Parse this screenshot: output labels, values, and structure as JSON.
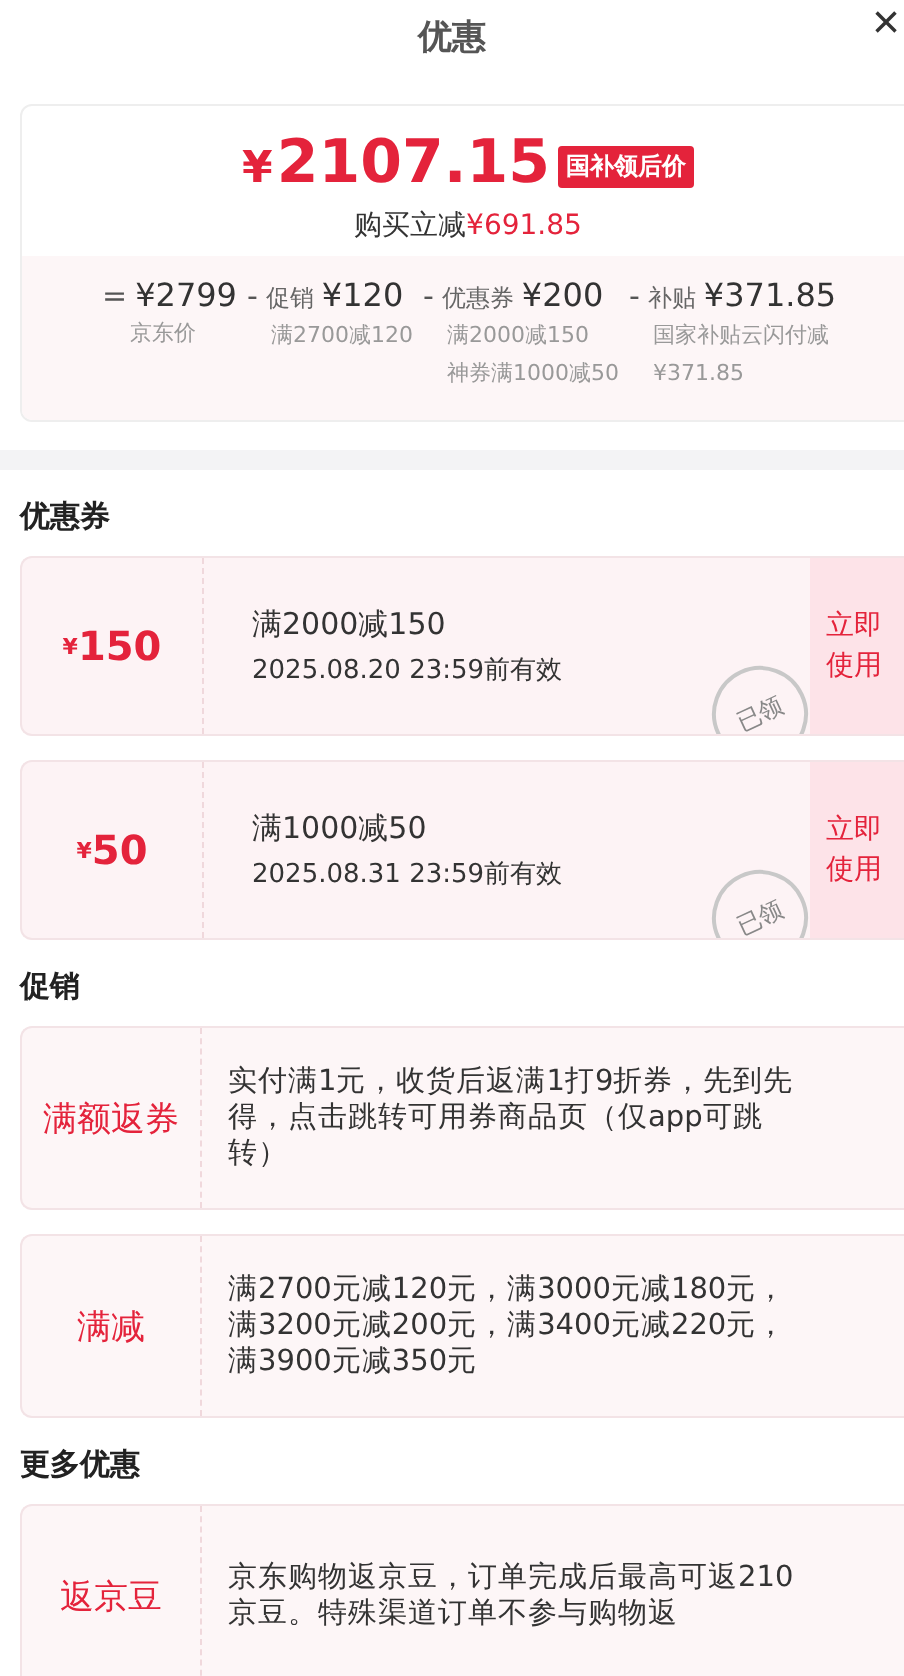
{
  "header": {
    "title": "优惠",
    "close": "×"
  },
  "price": {
    "currency": "¥",
    "amount": "2107.15",
    "badge": "国补领后价",
    "saving_label": "购买立减",
    "saving_amount": "¥691.85"
  },
  "breakdown": [
    {
      "sign": "=",
      "amount": "¥2799",
      "notes": [
        "京东价"
      ]
    },
    {
      "sign": "-",
      "label": "促销",
      "amount": "¥120",
      "notes": [
        "满2700减120"
      ]
    },
    {
      "sign": "-",
      "label": "优惠券",
      "amount": "¥200",
      "notes": [
        "满2000减150",
        "神券满1000减50"
      ]
    },
    {
      "sign": "-",
      "label": "补贴",
      "amount": "¥371.85",
      "notes": [
        "国家补贴云闪付减¥371.85"
      ]
    }
  ],
  "coupons_section": {
    "title": "优惠券",
    "coupons": [
      {
        "currency": "¥",
        "value": "150",
        "condition": "满2000减150",
        "validity": "2025.08.20 23:59前有效",
        "claimed": true,
        "stamp": "已领",
        "action": "立即使用"
      },
      {
        "currency": "¥",
        "value": "50",
        "condition": "满1000减50",
        "validity": "2025.08.31 23:59前有效",
        "claimed": true,
        "stamp": "已领",
        "action": "立即使用"
      }
    ]
  },
  "promotions_section": {
    "title": "促销",
    "items": [
      {
        "tag": "满额返券",
        "text": "实付满1元，收货后返满1打9折券，先到先得，点击跳转可用券商品页（仅app可跳转）"
      },
      {
        "tag": "满减",
        "text": "满2700元减120元，满3000元减180元，满3200元减200元，满3400元减220元，满3900元减350元"
      }
    ]
  },
  "more_section": {
    "title": "更多优惠",
    "items": [
      {
        "tag": "返京豆",
        "text": "京东购物返京豆，订单完成后最高可返210京豆。特殊渠道订单不参与购物返"
      }
    ]
  }
}
